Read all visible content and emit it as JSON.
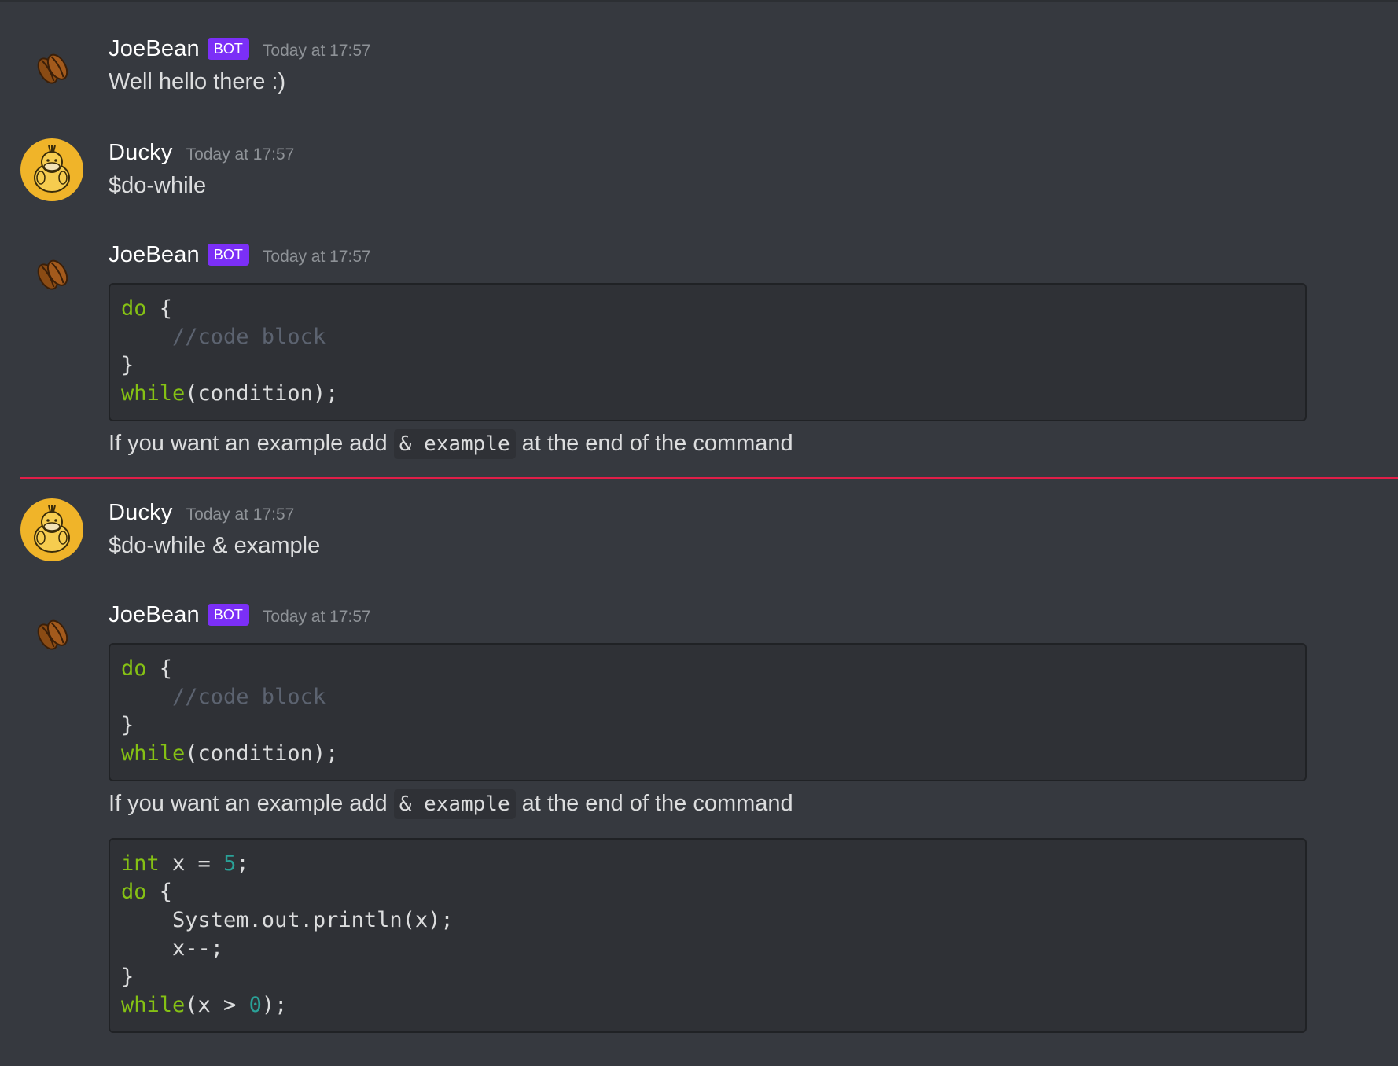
{
  "messages": [
    {
      "author": "JoeBean",
      "badge": "BOT",
      "timestamp": "Today at 17:57",
      "text": "Well hello there :)",
      "avatar_icon": "coffee-bean-icon"
    },
    {
      "author": "Ducky",
      "timestamp": "Today at 17:57",
      "text": "$do-while",
      "avatar_icon": "duck-icon"
    },
    {
      "author": "JoeBean",
      "badge": "BOT",
      "timestamp": "Today at 17:57",
      "avatar_icon": "coffee-bean-icon",
      "code": {
        "kw_do": "do",
        "brace_open": " {",
        "comment": "    //code block",
        "brace_close": "}",
        "kw_while": "while",
        "condition": "(condition);"
      },
      "note_prefix": "If you want an example add ",
      "note_code": "& example",
      "note_suffix": " at the end of the command"
    },
    {
      "author": "Ducky",
      "timestamp": "Today at 17:57",
      "text": "$do-while & example",
      "avatar_icon": "duck-icon"
    },
    {
      "author": "JoeBean",
      "badge": "BOT",
      "timestamp": "Today at 17:57",
      "avatar_icon": "coffee-bean-icon",
      "code": {
        "kw_do": "do",
        "brace_open": " {",
        "comment": "    //code block",
        "brace_close": "}",
        "kw_while": "while",
        "condition": "(condition);"
      },
      "note_prefix": "If you want an example add ",
      "note_code": "& example",
      "note_suffix": " at the end of the command",
      "example": {
        "kw_int": "int",
        "decl": " x = ",
        "num5": "5",
        "semi": ";",
        "kw_do": "do",
        "brace_open": " {",
        "print": "    System.out.println(x);",
        "dec": "    x--;",
        "brace_close": "}",
        "kw_while": "while",
        "cond_open": "(x > ",
        "num0": "0",
        "cond_close": ");"
      }
    }
  ],
  "colors": {
    "background": "#36393f",
    "code_background": "#2f3136",
    "bot_badge": "#7b2ff7",
    "new_messages_divider": "#e01e48",
    "keyword": "#85c114",
    "number": "#2aa198",
    "comment": "#5c6370"
  }
}
